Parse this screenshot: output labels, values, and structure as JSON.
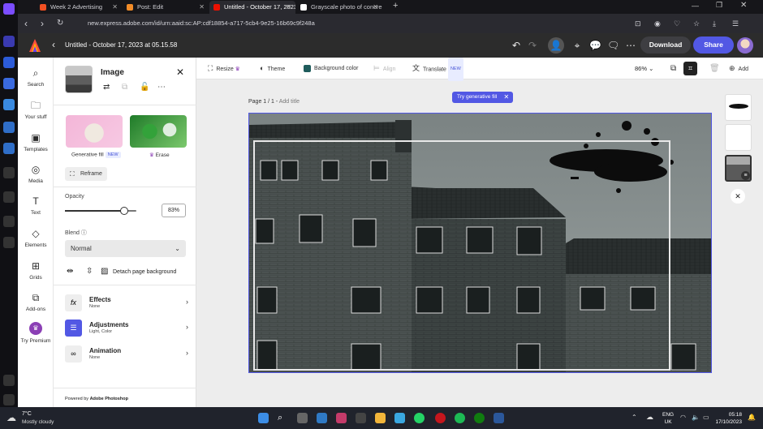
{
  "browser": {
    "tabs": [
      {
        "label": "Week 2 Advertising",
        "favicon_color": "#f25022"
      },
      {
        "label": "Post: Edit",
        "favicon_color": "#f28c28"
      },
      {
        "label": "Untitled - October 17, 2023",
        "favicon_color": "#eb1000"
      },
      {
        "label": "Grayscale photo of concre",
        "favicon_color": "#ffffff"
      }
    ],
    "active_tab": 2,
    "url": "new.express.adobe.com/id/urn:aaid:sc:AP:cdf18854-a717-5cb4-9e25-16b69c9f248a"
  },
  "app": {
    "doc_title": "Untitled - October 17, 2023 at 05.15.58",
    "download_label": "Download",
    "share_label": "Share",
    "accent_color": "#5258e4"
  },
  "leftnav": {
    "items": [
      {
        "label": "Search",
        "icon": "search-icon"
      },
      {
        "label": "Your stuff",
        "icon": "folder-icon"
      },
      {
        "label": "Templates",
        "icon": "templates-icon"
      },
      {
        "label": "Media",
        "icon": "media-icon"
      },
      {
        "label": "Text",
        "icon": "text-icon"
      },
      {
        "label": "Elements",
        "icon": "elements-icon"
      },
      {
        "label": "Grids",
        "icon": "grid-icon"
      },
      {
        "label": "Add-ons",
        "icon": "addons-icon"
      },
      {
        "label": "Try Premium",
        "icon": "crown-icon"
      }
    ]
  },
  "panel": {
    "title": "Image",
    "generative_fill_label": "Generative fill",
    "new_badge": "NEW",
    "erase_label": "Erase",
    "reframe_label": "Reframe",
    "opacity_label": "Opacity",
    "opacity_value": "83%",
    "opacity_fraction": 0.83,
    "blend_label": "Blend",
    "blend_value": "Normal",
    "detach_label": "Detach page background",
    "effects": {
      "title": "Effects",
      "sub": "None"
    },
    "adjustments": {
      "title": "Adjustments",
      "sub": "Light, Color"
    },
    "animation": {
      "title": "Animation",
      "sub": "None"
    },
    "powered_prefix": "Powered by ",
    "powered_brand": "Adobe Photoshop"
  },
  "toolbar": {
    "resize": "Resize",
    "theme": "Theme",
    "background_color": "Background color",
    "align": "Align",
    "translate": "Translate",
    "translate_badge": "NEW",
    "zoom": "86%",
    "add": "Add"
  },
  "canvas": {
    "page_label": "Page 1 / 1 - ",
    "add_title": "Add title",
    "gen_fill_chip": "Try generative fill"
  },
  "taskbar": {
    "temperature": "7°C",
    "weather": "Mostly cloudy",
    "lang_line1": "ENG",
    "lang_line2": "UK",
    "time": "05:18",
    "date": "17/10/2023"
  }
}
